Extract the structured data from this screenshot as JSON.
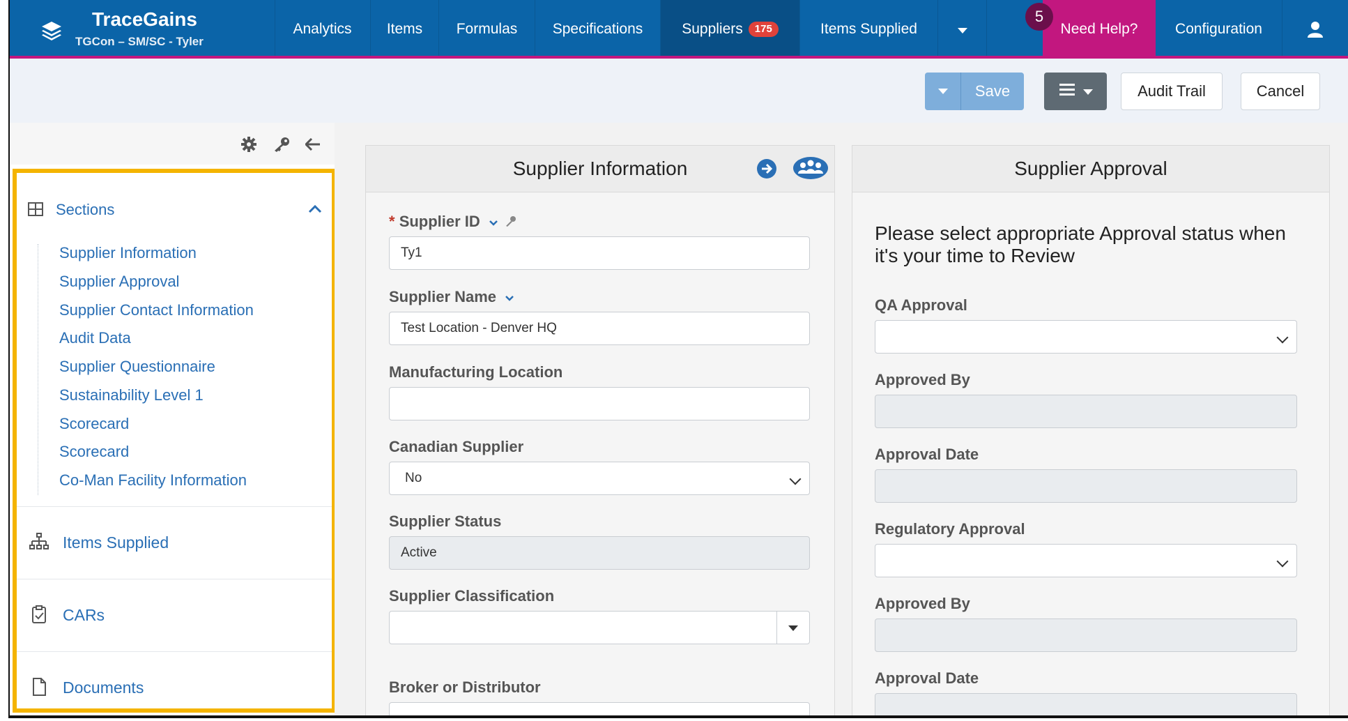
{
  "app": {
    "brand_title": "TraceGains",
    "brand_subtitle": "TGCon – SM/SC - Tyler"
  },
  "nav": {
    "items": [
      {
        "label": "Analytics"
      },
      {
        "label": "Items"
      },
      {
        "label": "Formulas"
      },
      {
        "label": "Specifications"
      },
      {
        "label": "Suppliers",
        "badge": "175"
      },
      {
        "label": "Items Supplied"
      }
    ],
    "help_label": "Need Help?",
    "help_count": "5",
    "config_label": "Configuration"
  },
  "toolbar": {
    "save_label": "Save",
    "audit_label": "Audit Trail",
    "cancel_label": "Cancel"
  },
  "sidebar": {
    "sections_label": "Sections",
    "sections": [
      "Supplier Information",
      "Supplier Approval",
      "Supplier Contact Information",
      "Audit Data",
      "Supplier Questionnaire",
      "Sustainability Level 1",
      "Scorecard",
      "Scorecard",
      "Co-Man Facility Information"
    ],
    "items_supplied_label": "Items Supplied",
    "cars_label": "CARs",
    "documents_label": "Documents"
  },
  "supplier_info": {
    "title": "Supplier Information",
    "supplier_id_label": "Supplier ID",
    "supplier_id_value": "Ty1",
    "supplier_name_label": "Supplier Name",
    "supplier_name_value": "Test Location - Denver HQ",
    "mfg_location_label": "Manufacturing Location",
    "mfg_location_value": "",
    "canadian_label": "Canadian Supplier",
    "canadian_value": "No",
    "status_label": "Supplier Status",
    "status_value": "Active",
    "classification_label": "Supplier Classification",
    "broker_label": "Broker or Distributor"
  },
  "supplier_approval": {
    "title": "Supplier Approval",
    "note": "Please select appropriate Approval status when it's your time to Review",
    "qa_label": "QA Approval",
    "approved_by_label": "Approved By",
    "approval_date_label": "Approval Date",
    "regulatory_label": "Regulatory Approval",
    "approved_by2_label": "Approved By",
    "approval_date2_label": "Approval Date"
  },
  "colors": {
    "nav_bg": "#0b64a8",
    "help_bg": "#c2177f",
    "highlight_border": "#f4b400",
    "link": "#2a6fb5"
  }
}
